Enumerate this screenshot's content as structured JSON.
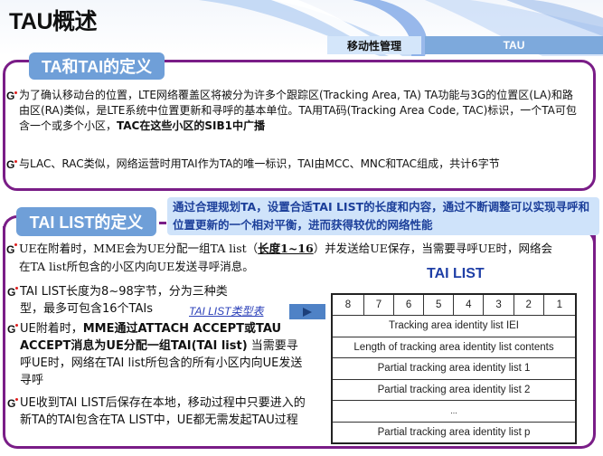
{
  "page": {
    "title": "TAU概述",
    "breadcrumb": [
      "移动性管理",
      "TAU"
    ]
  },
  "section1": {
    "tab_label": "TA和TAI的定义",
    "bullets": [
      {
        "text": "为了确认移动台的位置，LTE网络覆盖区将被分为许多个跟踪区(Tracking Area, TA) TA功能与3G的位置区(LA)和路由区(RA)类似，是LTE系统中位置更新和寻呼的基本单位。TA用TA码(Tracking Area Code, TAC)标识，一个TA可包含一个或多个小区，",
        "bold": "TAC在这些小区的SIB1中广播"
      },
      {
        "text": "与LAC、RAC类似，网络运营时用TAI作为TA的唯一标识，TAI由MCC、MNC和TAC组成，共计6字节"
      }
    ]
  },
  "section2": {
    "tab_label": "TAI LIST的定义",
    "callout": "通过合理规划TA，设置合适TAI LIST的长度和内容，通过不断调整可以实现寻呼和位置更新的一个相对平衡，进而获得较优的网络性能",
    "bullets": [
      {
        "pre": "UE在附着时，MME会为UE分配一组TA list（",
        "underline": "长度1~16",
        "post": "）并发送给UE保存，当需要寻呼UE时，网络会在TA list所包含的小区内向UE发送寻呼消息。"
      },
      {
        "text": "TAI LIST长度为8~98字节，分为三种类型，最多可包含16个TAIs"
      },
      {
        "pre": "UE附着时，",
        "bold": "MME通过ATTACH ACCEPT或TAU ACCEPT消息为UE分配一组TAI(TAI list)",
        "post": " 当需要寻呼UE时，网络在TAI list所包含的所有小区内向UE发送寻呼"
      },
      {
        "text": "UE收到TAI LIST后保存在本地，移动过程中只要进入的新TA的TAI包含在TA LIST中，UE都无需发起TAU过程"
      }
    ],
    "link_label": "TAI LIST类型表",
    "play_icon": "play-icon"
  },
  "tai_table": {
    "title": "TAI LIST",
    "bits": [
      "8",
      "7",
      "6",
      "5",
      "4",
      "3",
      "2",
      "1"
    ],
    "rows": [
      "Tracking area identity list IEI",
      "Length of tracking area identity list contents",
      "Partial tracking area identity list 1",
      "Partial tracking area identity list 2",
      "...",
      "Partial tracking area identity list p"
    ]
  },
  "colors": {
    "panel_border": "#7a1d87",
    "tab_bg": "#6f9fd8",
    "callout_bg": "#cfe3fa",
    "callout_text": "#1c3f9a",
    "table_title": "#1f3fa6"
  }
}
